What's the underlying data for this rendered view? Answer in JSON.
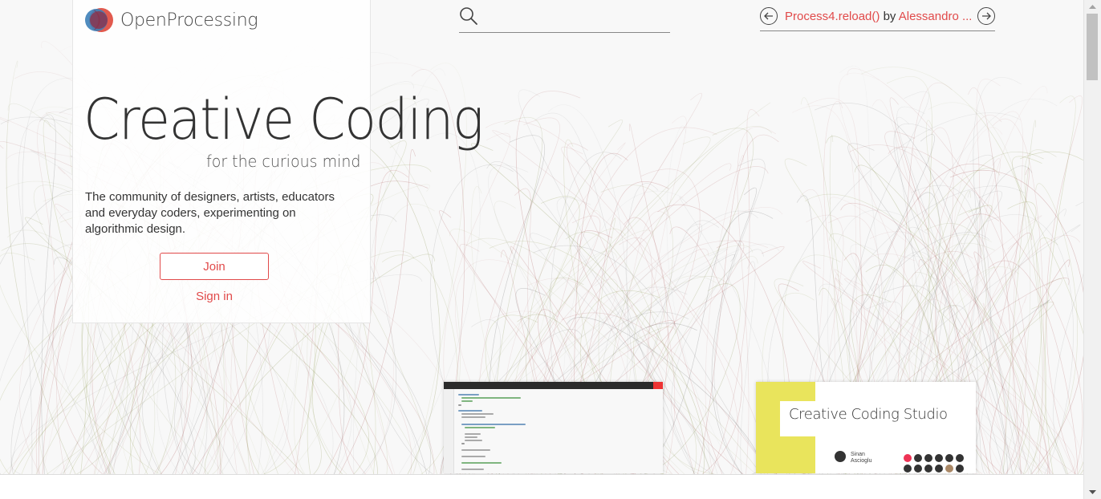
{
  "brand": {
    "name": "OpenProcessing"
  },
  "hero": {
    "title": "Creative Coding",
    "subtitle": "for the curious mind",
    "description": "The community of designers, artists, educators and everyday coders, experimenting on algorithmic design.",
    "join_label": "Join",
    "signin_label": "Sign in"
  },
  "search": {
    "placeholder": "",
    "value": ""
  },
  "featured": {
    "sketch_title": "Process4.reload()",
    "by_label": "by",
    "author": "Alessandro ...",
    "prev_icon": "arrow-left-circle-icon",
    "next_icon": "arrow-right-circle-icon"
  },
  "studio_preview": {
    "title": "Creative Coding Studio",
    "person": "Sinan Ascioglu"
  },
  "colors": {
    "accent": "#e14a4a",
    "studio_yellow": "#e9e45c",
    "text": "#333333"
  }
}
